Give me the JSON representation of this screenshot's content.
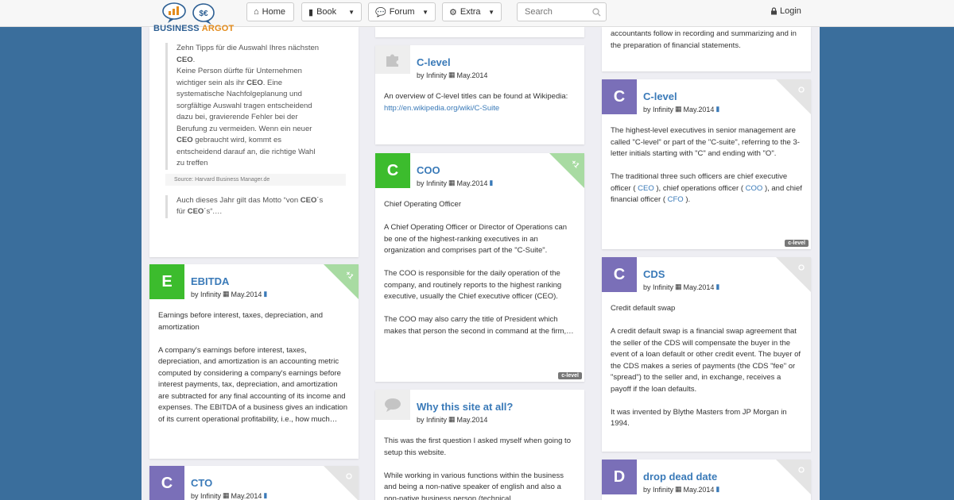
{
  "nav": {
    "brand_a": "BUSINESS",
    "brand_b": "ARGOT",
    "home": "Home",
    "book": "Book",
    "forum": "Forum",
    "extra": "Extra",
    "search_placeholder": "Search",
    "login": "Login"
  },
  "col1": {
    "quote_intro": "Zehn Tipps für die Auswahl Ihres nächsten",
    "quote_ceo1": "CEO",
    "quote_l2": "Keine Person dürfte für Unternehmen",
    "quote_l3a": "wichtiger sein als ihr ",
    "quote_ceo2": "CEO",
    "quote_l3b": ". Eine",
    "quote_l4": "systematische Nachfolgeplanung und",
    "quote_l5": "sorgfältige Auswahl tragen entscheidend",
    "quote_l6": "dazu bei, gravierende Fehler bei der",
    "quote_l7": "Berufung zu vermeiden. Wenn ein neuer",
    "quote_ceo3": "CEO",
    "quote_l8": " gebraucht wird, kommt es",
    "quote_l9": "entscheidend darauf an, die richtige Wahl",
    "quote_l10": "zu treffen",
    "quote_source": "Source: Harvard Business Manager.de",
    "quote2_a": "Auch dieses Jahr gilt das Motto “von ",
    "quote2_ceo": "CEO",
    "quote2_b": "´s",
    "quote2_c": "für ",
    "quote2_ceo2": "CEO",
    "quote2_d": "´s“.…"
  },
  "cards": {
    "ebitda": {
      "letter": "E",
      "title": "EBITDA",
      "by": "by Infinity",
      "date": "May.2014",
      "ribbon": "+1",
      "p1": "Earnings before interest, taxes, depreciation, and amortization",
      "p2": "A company's earnings before interest, taxes, depreciation, and amortization is an accounting metric computed by considering a company's earnings before interest payments, tax, depreciation, and amortization are subtracted for any final accounting of its income and expenses. The EBITDA of a business gives an indication of its current operational profitability, i.e., how much…"
    },
    "cto": {
      "letter": "C",
      "title": "CTO",
      "by": "by Infinity",
      "date": "May.2014"
    },
    "clevel1": {
      "title": "C-level",
      "by": "by Infinity",
      "date": "May.2014",
      "p1": "An overview of C-level titles can be found at Wikipedia: ",
      "link": "http://en.wikipedia.org/wiki/C-Suite"
    },
    "coo": {
      "letter": "C",
      "title": "COO",
      "by": "by Infinity",
      "date": "May.2014",
      "ribbon": "+1",
      "tag": "c-level",
      "p1": "Chief Operating Officer",
      "p2": "A Chief Operating Officer or Director of Operations can be one of the highest-ranking executives in an organization and comprises part of the \"C-Suite\".",
      "p3": "The COO is responsible for the daily operation of the company, and routinely reports to the highest ranking executive, usually the Chief executive officer (CEO).",
      "p4": "The COO may also carry the title of President which makes that person the second in command at the firm,…"
    },
    "why": {
      "title": "Why this site at all?",
      "by": "by Infinity",
      "date": "May.2014",
      "p1": "This was the first question I asked myself when going to setup this website.",
      "p2": "While working in various functions within the business and being a non-native speaker of english and also a non-native business person (technical"
    },
    "top3": {
      "text": "accountants follow in recording and summarizing and in the preparation of financial statements."
    },
    "clevel2": {
      "letter": "C",
      "title": "C-level",
      "by": "by Infinity",
      "date": "May.2014",
      "tag": "c-level",
      "p1": "The highest-level executives in senior management are called \"C-level\" or part of the \"C-suite\", referring to the 3-letter initials starting with \"C\" and ending with \"O\".",
      "p2a": "The traditional three such officers are chief executive officer ( ",
      "ceo": "CEO",
      "p2b": " ), chief operations officer ( ",
      "coo": "COO",
      "p2c": " ), and chief financial officer ( ",
      "cfo": "CFO",
      "p2d": " )."
    },
    "cds": {
      "letter": "C",
      "title": "CDS",
      "by": "by Infinity",
      "date": "May.2014",
      "p1": "Credit default swap",
      "p2": "A credit default swap is a financial swap agreement that the seller of the CDS will compensate the buyer in the event of a loan default or other credit event. The buyer of the CDS makes a series of payments (the CDS \"fee\" or \"spread\") to the seller and, in exchange, receives a payoff if the loan defaults.",
      "p3": "It was invented by Blythe Masters from JP Morgan in 1994."
    },
    "ddd": {
      "letter": "D",
      "title": "drop dead date",
      "by": "by Infinity",
      "date": "May.2014"
    }
  },
  "colors": {
    "green": "#3cbc2d",
    "purple": "#7a6fb8",
    "link": "#3a7ab8",
    "ribbon_green": "#a8dba2",
    "ribbon_gray": "#e4e4e4"
  }
}
